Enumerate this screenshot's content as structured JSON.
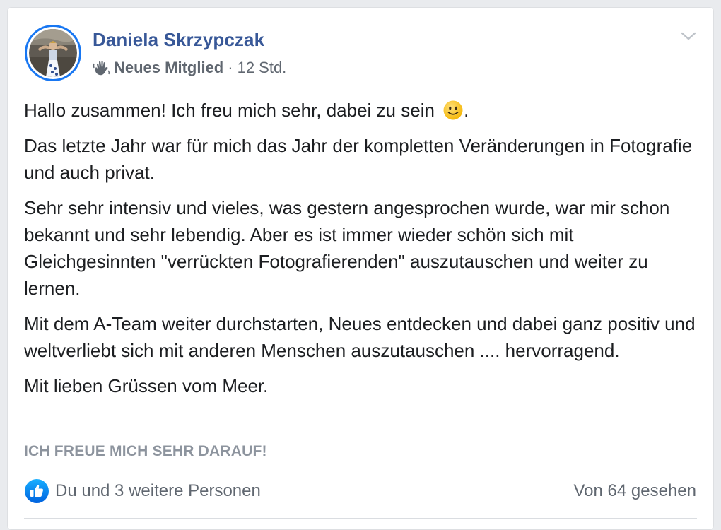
{
  "post": {
    "author_name": "Daniela Skrzypczak",
    "badge_icon": "waving-hand-icon",
    "badge_label": "Neues Mitglied",
    "separator": "·",
    "timestamp": "12 Std.",
    "menu_icon": "chevron-down-icon",
    "paragraphs": {
      "p1": "Hallo zusammen! Ich freu mich sehr, dabei zu sein",
      "p1_end": ".",
      "p2": "Das letzte Jahr war für mich das Jahr der kompletten Veränderungen in Fotografie und auch privat.",
      "p3": "Sehr sehr intensiv und vieles, was gestern angesprochen wurde, war mir schon bekannt und sehr lebendig. Aber es ist immer wieder schön sich mit Gleichgesinnten \"verrückten Fotografierenden\" auszutauschen und weiter zu lernen.",
      "p4": "Mit dem A-Team weiter durchstarten, Neues entdecken und dabei ganz positiv und weltverliebt sich mit anderen Menschen auszutauschen .... hervorragend.",
      "p5": "Mit lieben Grüssen vom Meer."
    },
    "emoji_icon": "slightly-smiling-face-icon",
    "intro_answer": "ICH FREUE MICH SEHR DARAUF!",
    "reactions_icon": "like-thumbs-up-icon",
    "reactions_text": "Du und 3 weitere Personen",
    "seen_text": "Von 64 gesehen"
  },
  "colors": {
    "name_link": "#385898",
    "accent_blue": "#1877f2",
    "secondary_text": "#606770",
    "muted_text": "#8d949e",
    "card_bg": "#ffffff",
    "page_bg": "#e9ebee"
  }
}
